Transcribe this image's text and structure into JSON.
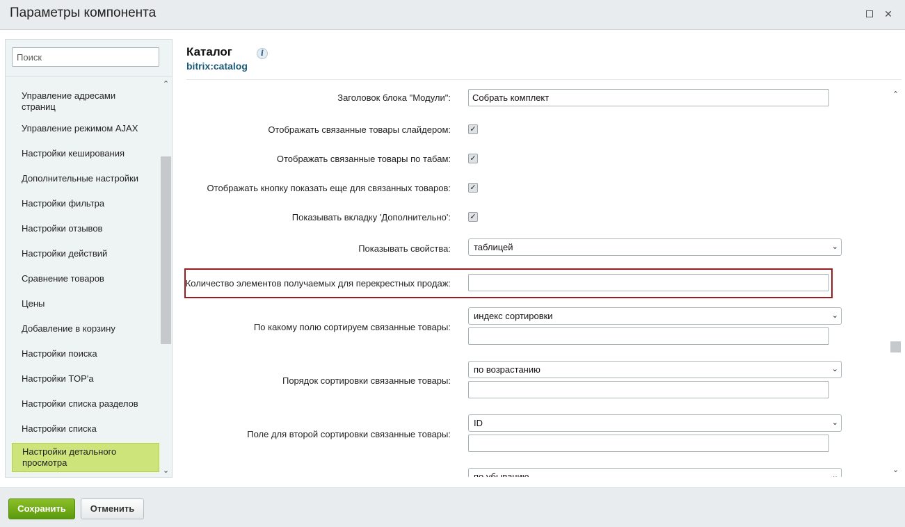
{
  "window": {
    "title": "Параметры компонента",
    "maximize_icon": "maximize-icon",
    "close_icon": "close-icon",
    "close_glyph": "✕"
  },
  "search": {
    "placeholder": "Поиск"
  },
  "sidebar": {
    "items": [
      {
        "label": "Управление адресами страниц",
        "active": false
      },
      {
        "label": "Управление режимом AJAX",
        "active": false
      },
      {
        "label": "Настройки кеширования",
        "active": false
      },
      {
        "label": "Дополнительные настройки",
        "active": false
      },
      {
        "label": "Настройки фильтра",
        "active": false
      },
      {
        "label": "Настройки отзывов",
        "active": false
      },
      {
        "label": "Настройки действий",
        "active": false
      },
      {
        "label": "Сравнение товаров",
        "active": false
      },
      {
        "label": "Цены",
        "active": false
      },
      {
        "label": "Добавление в корзину",
        "active": false
      },
      {
        "label": "Настройки поиска",
        "active": false
      },
      {
        "label": "Настройки TOP'а",
        "active": false
      },
      {
        "label": "Настройки списка разделов",
        "active": false
      },
      {
        "label": "Настройки списка",
        "active": false
      },
      {
        "label": "Настройки детального просмотра",
        "active": true
      }
    ],
    "scroll_up_glyph": "⌃",
    "scroll_down_glyph": "⌄"
  },
  "component": {
    "title": "Каталог",
    "code": "bitrix:catalog",
    "info_glyph": "i"
  },
  "fields": {
    "modules_title": {
      "label": "Заголовок блока \"Модули\":",
      "value": "Собрать комплект"
    },
    "slider": {
      "label": "Отображать связанные товары слайдером:",
      "checked": true
    },
    "tabs": {
      "label": "Отображать связанные товары по табам:",
      "checked": true
    },
    "show_more": {
      "label": "Отображать кнопку показать еще для связанных товаров:",
      "checked": true
    },
    "additional_tab": {
      "label": "Показывать вкладку 'Дополнительно':",
      "checked": true
    },
    "show_props": {
      "label": "Показывать свойства:",
      "value": "таблицей"
    },
    "cross_count": {
      "label": "Количество элементов получаемых для перекрестных продаж:",
      "value": ""
    },
    "sort_field": {
      "label": "По какому полю сортируем связанные товары:",
      "value": "индекс сортировки",
      "extra": ""
    },
    "sort_order": {
      "label": "Порядок сортировки связанные товары:",
      "value": "по возрастанию",
      "extra": ""
    },
    "sort_field2": {
      "label": "Поле для второй сортировки связанные товары:",
      "value": "ID",
      "extra": ""
    },
    "sort_order2": {
      "value": "по убыванию"
    },
    "check_glyph": "✓",
    "chevron_glyph": "⌄"
  },
  "footer": {
    "save_label": "Сохранить",
    "cancel_label": "Отменить"
  }
}
